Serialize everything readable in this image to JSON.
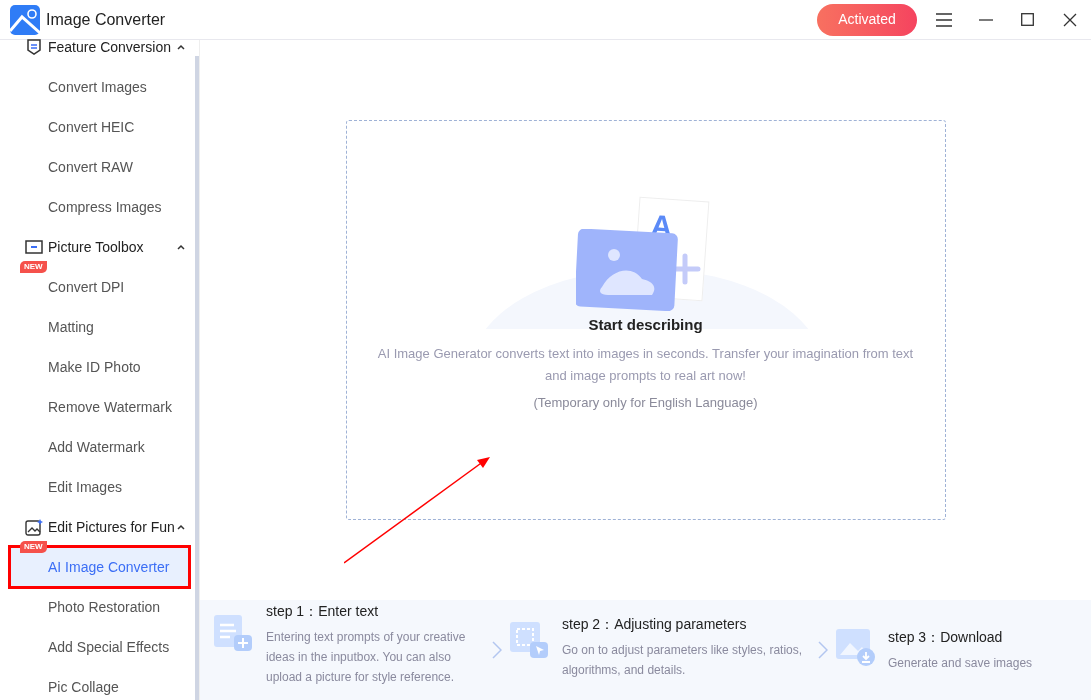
{
  "window": {
    "title": "Image Converter",
    "activated_label": "Activated"
  },
  "sidebar": {
    "groups": [
      {
        "title": "Feature Conversion",
        "expanded": true,
        "items": [
          {
            "label": "Convert Images",
            "selected": false
          },
          {
            "label": "Convert HEIC",
            "selected": false
          },
          {
            "label": "Convert RAW",
            "selected": false
          },
          {
            "label": "Compress Images",
            "selected": false
          }
        ]
      },
      {
        "title": "Picture Toolbox",
        "expanded": true,
        "items": [
          {
            "label": "Convert DPI",
            "selected": false,
            "badge": "NEW"
          },
          {
            "label": "Matting",
            "selected": false
          },
          {
            "label": "Make ID Photo",
            "selected": false
          },
          {
            "label": "Remove Watermark",
            "selected": false
          },
          {
            "label": "Add Watermark",
            "selected": false
          },
          {
            "label": "Edit Images",
            "selected": false
          }
        ]
      },
      {
        "title": "Edit Pictures for Fun",
        "expanded": true,
        "items": [
          {
            "label": "AI Image Converter",
            "selected": true,
            "badge": "NEW"
          },
          {
            "label": "Photo Restoration",
            "selected": false
          },
          {
            "label": "Add Special Effects",
            "selected": false
          },
          {
            "label": "Pic Collage",
            "selected": false
          }
        ]
      }
    ]
  },
  "drop_area": {
    "illustration_letter": "A",
    "title": "Start describing",
    "description": "AI Image Generator converts text into images in seconds. Transfer your imagination from text and image prompts to real art now!",
    "note": "(Temporary only for English Language)"
  },
  "steps": [
    {
      "title": "step 1：Enter text",
      "description": "Entering text prompts of your creative ideas in the inputbox. You can also upload a picture for style reference."
    },
    {
      "title": "step 2：Adjusting parameters",
      "description": "Go on to adjust parameters like styles, ratios, algorithms, and details."
    },
    {
      "title": "step 3：Download",
      "description": "Generate and save images"
    }
  ]
}
